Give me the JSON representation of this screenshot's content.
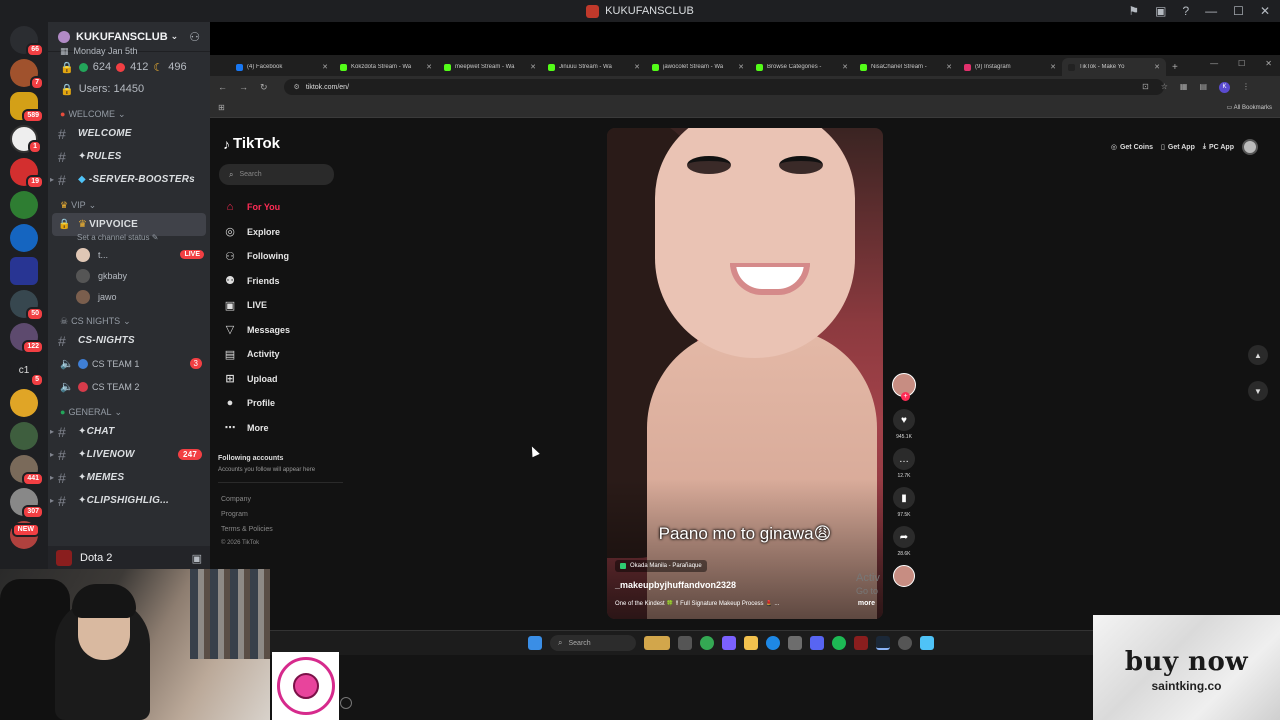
{
  "discord": {
    "window_title": "KUKUFANSCLUB",
    "guild": {
      "name": "KUKUFANSCLUB",
      "date_partial": "Monday Jan 5th",
      "stats": {
        "online": "624",
        "dnd": "412",
        "idle": "496"
      },
      "users": "Users: 14450"
    },
    "rail": {
      "badges": [
        "66",
        "7",
        "589",
        "1",
        "19",
        "50",
        "122",
        "5",
        "441",
        "307"
      ],
      "new_label": "NEW",
      "c1": "c1"
    },
    "categories": {
      "welcome": "WELCOME",
      "vip": "VIP",
      "cs_nights": "CS NIGHTS",
      "general": "GENERAL"
    },
    "channels": {
      "welcome": "WELCOME",
      "rules": "✦RULES",
      "server_boosters": "-SERVER-BOOSTERs",
      "vipvoice": "VIPVOICE",
      "vipvoice_status": "Set a channel status",
      "cs_nights": "CS-NIGHTS",
      "cs_team1": "CS TEAM 1",
      "cs_team1_count": "3",
      "cs_team2": "CS TEAM 2",
      "chat": "✦CHAT",
      "livenow": "✦LIVENOW",
      "livenow_count": "247",
      "memes": "✦MEMES",
      "clipshighlig": "✦CLIPSHIGHLIG..."
    },
    "voice_users": [
      {
        "name": "t...",
        "live": "LIVE"
      },
      {
        "name": "gkbaby"
      },
      {
        "name": "jawo"
      }
    ],
    "activity_bar": {
      "game": "Dota 2"
    }
  },
  "browser": {
    "tabs": [
      {
        "label": "(4) Facebook",
        "color": "#1877f2"
      },
      {
        "label": "Kokzdota Stream - Wa",
        "color": "#53fc18"
      },
      {
        "label": "meepwet Stream - Wa",
        "color": "#53fc18"
      },
      {
        "label": "Jinuuu Stream - Wa",
        "color": "#53fc18"
      },
      {
        "label": "jawocolet Stream - Wa",
        "color": "#53fc18"
      },
      {
        "label": "Browse Categories -",
        "color": "#53fc18"
      },
      {
        "label": "NisaChanel Stream -",
        "color": "#53fc18"
      },
      {
        "label": "(9) Instagram",
        "color": "#e1306c"
      },
      {
        "label": "TikTok - Make Yo",
        "color": "#222222"
      }
    ],
    "url": "tiktok.com/en/",
    "all_bookmarks": "All Bookmarks"
  },
  "tiktok": {
    "logo": "TikTok",
    "search_placeholder": "Search",
    "nav": [
      {
        "label": "For You",
        "icon": "home-icon",
        "glyph": "⌂",
        "active": true
      },
      {
        "label": "Explore",
        "icon": "compass-icon",
        "glyph": "◎"
      },
      {
        "label": "Following",
        "icon": "following-icon",
        "glyph": "⚇"
      },
      {
        "label": "Friends",
        "icon": "friends-icon",
        "glyph": "⚉"
      },
      {
        "label": "LIVE",
        "icon": "live-icon",
        "glyph": "▣"
      },
      {
        "label": "Messages",
        "icon": "messages-icon",
        "glyph": "▽"
      },
      {
        "label": "Activity",
        "icon": "activity-icon",
        "glyph": "▤"
      },
      {
        "label": "Upload",
        "icon": "upload-icon",
        "glyph": "⊞"
      },
      {
        "label": "Profile",
        "icon": "profile-icon",
        "glyph": "●"
      },
      {
        "label": "More",
        "icon": "more-icon",
        "glyph": "⋯"
      }
    ],
    "following_accounts_title": "Following accounts",
    "following_accounts_sub": "Accounts you follow will appear here",
    "footer": [
      "Company",
      "Program",
      "Terms & Policies",
      "© 2026 TikTok"
    ],
    "top_right": {
      "coins": "Get Coins",
      "app": "Get App",
      "pc": "PC App"
    },
    "video": {
      "caption": "Paano mo to ginawa😩",
      "location": "Okada Manila - Parañaque",
      "username": "_makeupbyjhuffandvon2328",
      "description": "One of the Kindest 🍀 ‼ Full Signature Makeup Process 💄 ...",
      "more": "more"
    },
    "actions": {
      "likes": "945.1K",
      "comments": "12.7K",
      "saves": "97.5K",
      "shares": "28.6K"
    }
  },
  "taskbar": {
    "search": "Search"
  },
  "watermark": {
    "line1": "Activ",
    "line2": "Go to"
  },
  "ad": {
    "headline": "buy now",
    "site": "saintking.co"
  }
}
